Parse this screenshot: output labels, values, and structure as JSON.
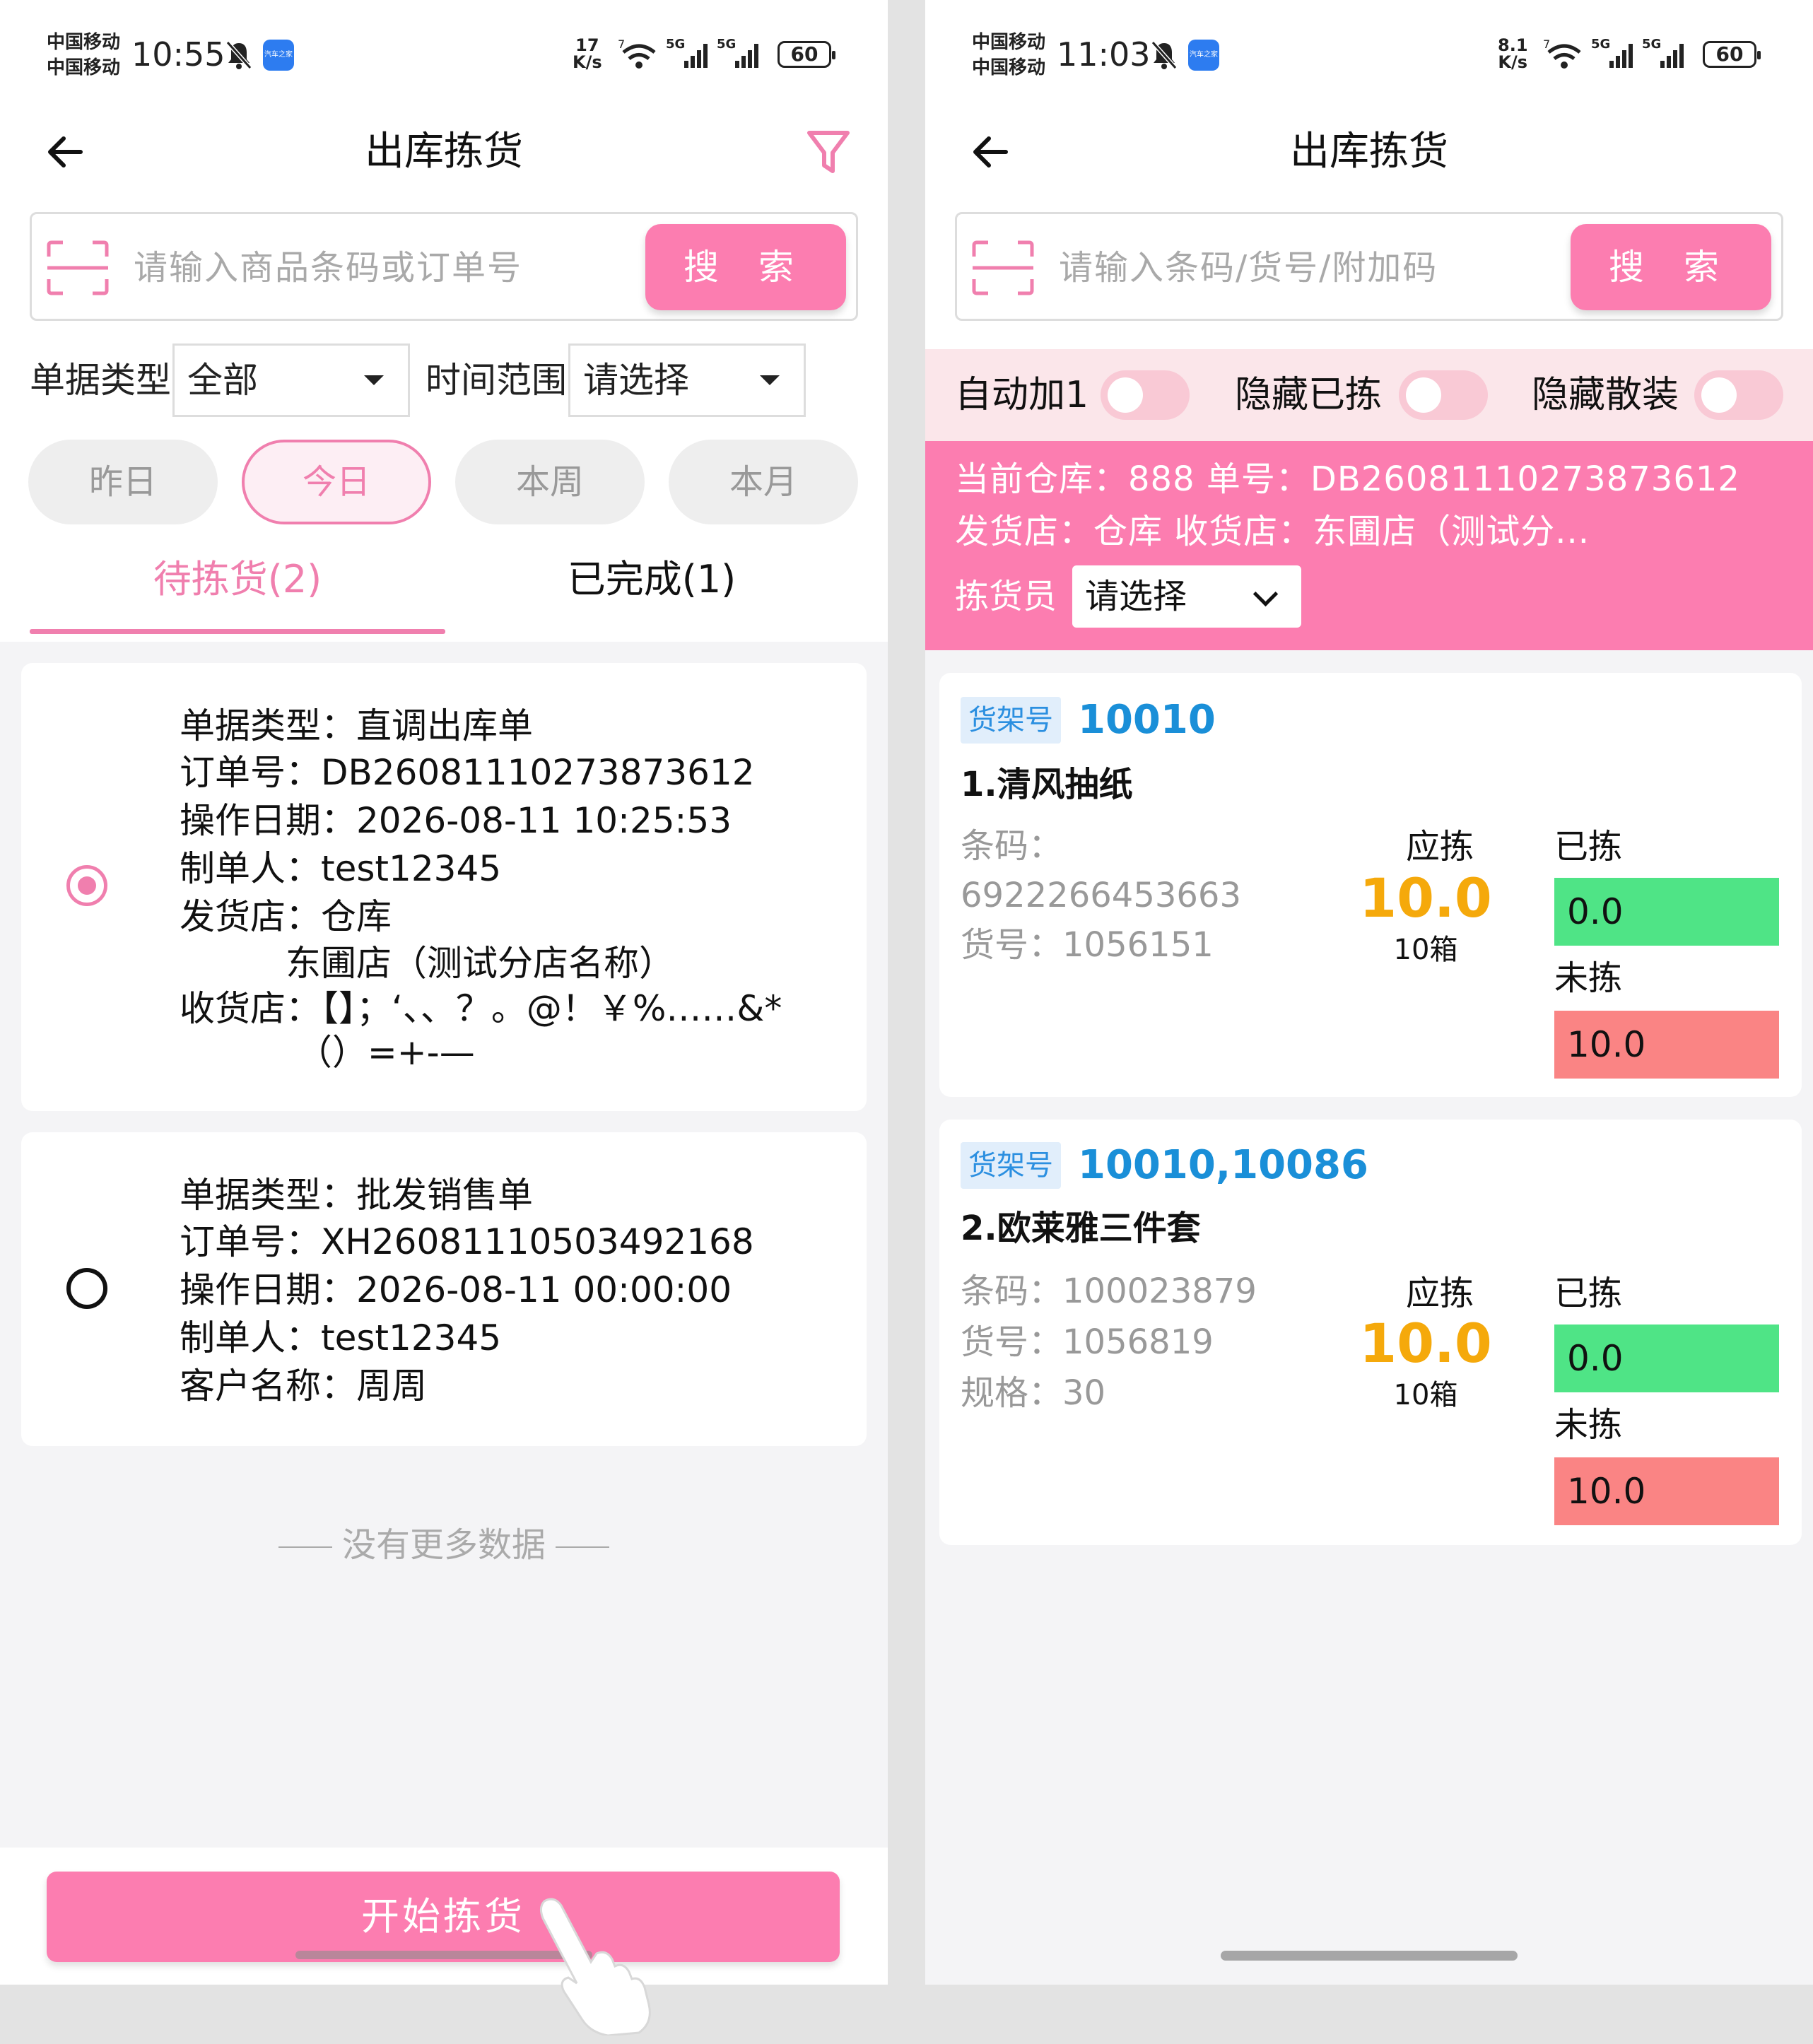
{
  "colors": {
    "accent": "#fc7db0",
    "accent_text": "#f07fae",
    "qty_yellow": "#f5a90b",
    "picked_green": "#4fe486",
    "unpicked_red": "#fa8484",
    "shelf_blue": "#1a8fd8"
  },
  "left": {
    "status": {
      "carrier1": "中国移动",
      "carrier2": "中国移动",
      "time": "10:55",
      "net_speed_value": "17",
      "net_speed_unit": "K/s",
      "wifi_badge": "7",
      "signal_label": "5G",
      "signal2_label": "5G",
      "battery": "60",
      "app_icon": "汽车之家"
    },
    "header": {
      "title": "出库拣货"
    },
    "search": {
      "placeholder": "请输入商品条码或订单号",
      "button": "搜 索"
    },
    "filters": {
      "doc_type_label": "单据类型",
      "doc_type_value": "全部",
      "time_range_label": "时间范围",
      "time_range_value": "请选择"
    },
    "quick_ranges": [
      {
        "label": "昨日"
      },
      {
        "label": "今日"
      },
      {
        "label": "本周"
      },
      {
        "label": "本月"
      }
    ],
    "active_range": "今日",
    "tabs": [
      {
        "label": "待拣货(2)"
      },
      {
        "label": "已完成(1)"
      }
    ],
    "orders": [
      {
        "selected": true,
        "lines": [
          "单据类型：直调出库单",
          "订单号：DB26081110273873612",
          "操作日期：2026-08-11 10:25:53",
          "制单人：test12345",
          "发货店：仓库",
          "　　　东圃店（测试分店名称）",
          "收货店：【】；‘、、？。@！￥%……&*",
          "　　　 （）=+-—"
        ]
      },
      {
        "selected": false,
        "lines": [
          "单据类型：批发销售单",
          "订单号：XH26081110503492168",
          "操作日期：2026-08-11 00:00:00",
          "制单人：test12345",
          "客户名称：周周"
        ]
      }
    ],
    "no_more": "没有更多数据",
    "start_button": "开始拣货"
  },
  "right": {
    "status": {
      "carrier1": "中国移动",
      "carrier2": "中国移动",
      "time": "11:03",
      "net_speed_value": "8.1",
      "net_speed_unit": "K/s",
      "wifi_badge": "7",
      "signal_label": "5G",
      "signal2_label": "5G",
      "battery": "60",
      "app_icon": "汽车之家"
    },
    "header": {
      "title": "出库拣货"
    },
    "search": {
      "placeholder": "请输入条码/货号/附加码",
      "button": "搜 索"
    },
    "toggles": [
      {
        "label": "自动加1",
        "on": false
      },
      {
        "label": "隐藏已拣",
        "on": false
      },
      {
        "label": "隐藏散装",
        "on": false
      }
    ],
    "info": {
      "line1": "当前仓库：888  单号：DB26081110273873612",
      "line2": "发货店：仓库  收货店：东圃店（测试分...",
      "picker_label": "拣货员",
      "picker_value": "请选择"
    },
    "items": [
      {
        "shelf_tag": "货架号",
        "shelf_no": "10010",
        "name": "1.清风抽纸",
        "details": [
          "条码：",
          "6922266453663",
          "货号：1056151"
        ],
        "due_label": "应拣",
        "due_qty": "10.0",
        "due_unit": "10箱",
        "picked_label": "已拣",
        "picked_qty": "0.0",
        "unpicked_label": "未拣",
        "unpicked_qty": "10.0"
      },
      {
        "shelf_tag": "货架号",
        "shelf_no": "10010,10086",
        "name": "2.欧莱雅三件套",
        "details": [
          "条码：100023879",
          "货号：1056819",
          "规格：30"
        ],
        "due_label": "应拣",
        "due_qty": "10.0",
        "due_unit": "10箱",
        "picked_label": "已拣",
        "picked_qty": "0.0",
        "unpicked_label": "未拣",
        "unpicked_qty": "10.0"
      }
    ]
  }
}
